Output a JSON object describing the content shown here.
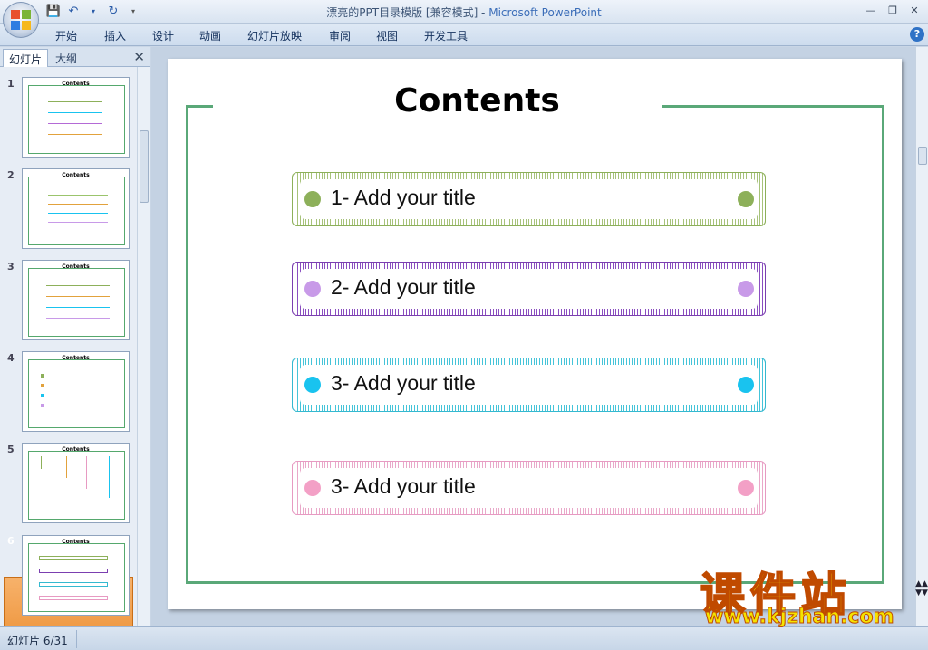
{
  "window": {
    "title_doc": "漂亮的PPT目录模版 [兼容模式] - ",
    "title_app": "Microsoft PowerPoint"
  },
  "menu": [
    "开始",
    "插入",
    "设计",
    "动画",
    "幻灯片放映",
    "审阅",
    "视图",
    "开发工具"
  ],
  "pane": {
    "tab_slides": "幻灯片",
    "tab_outline": "大纲"
  },
  "thumbnails": [
    {
      "num": "1",
      "title": "Contents"
    },
    {
      "num": "2",
      "title": "Contents"
    },
    {
      "num": "3",
      "title": "Contents"
    },
    {
      "num": "4",
      "title": "Contents"
    },
    {
      "num": "5",
      "title": "Contents"
    },
    {
      "num": "6",
      "title": "Contents"
    }
  ],
  "slide": {
    "title": "Contents",
    "items": [
      {
        "label": "1- Add your title",
        "color": "#8db05a",
        "stripe": "#a7c27a",
        "dot": "#8db05a"
      },
      {
        "label": "2- Add your title",
        "color": "#7b3fb0",
        "stripe": "#8a4ec0",
        "dot": "#c89ae8"
      },
      {
        "label": "3- Add your title",
        "color": "#35b9d0",
        "stripe": "#45c4d9",
        "dot": "#19c3ef"
      },
      {
        "label": "3- Add your title",
        "color": "#e79ac2",
        "stripe": "#e9a8c9",
        "dot": "#f3a0c6"
      }
    ]
  },
  "status": {
    "slide_info": "幻灯片 6/31"
  },
  "watermark": {
    "cn": "课件站",
    "url": "www.kjzhan.com"
  },
  "colors": {
    "frame": "#5aa878",
    "selected_thumb": "#ea8a2b"
  }
}
